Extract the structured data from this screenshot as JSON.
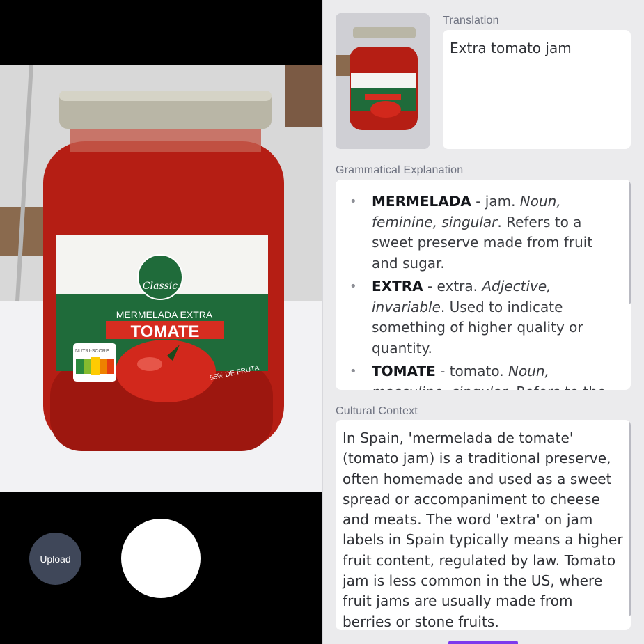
{
  "camera": {
    "upload_label": "Upload",
    "jar_label": {
      "brand": "Classic",
      "subtitle": "MERMELADA EXTRA",
      "title": "TOMATE",
      "nutri_score_label": "NUTRI-SCORE",
      "nutri_letters": [
        "A",
        "B",
        "C",
        "D",
        "E"
      ],
      "fruit_percent": "55% DE FRUTA"
    },
    "colors": {
      "jar_red": "#b51e14",
      "label_green": "#1f6b3a",
      "lid": "#b9b6a6",
      "upload_bg": "#3f4759"
    }
  },
  "panel": {
    "translation": {
      "label": "Translation",
      "text": "Extra tomato jam"
    },
    "grammar": {
      "label": "Grammatical Explanation",
      "items": [
        {
          "term": "MERMELADA",
          "meaning": " - jam. ",
          "grammar": "Noun, feminine, singular",
          "description": ". Refers to a sweet preserve made from fruit and sugar."
        },
        {
          "term": "EXTRA",
          "meaning": " - extra. ",
          "grammar": "Adjective, invariable",
          "description": ". Used to indicate something of higher quality or quantity."
        },
        {
          "term": "TOMATE",
          "meaning": " - tomato. ",
          "grammar": "Noun, masculine, singular",
          "description": ". Refers to the fruit."
        }
      ]
    },
    "culture": {
      "label": "Cultural Context",
      "text": "In Spain, 'mermelada de tomate' (tomato jam) is a traditional preserve, often homemade and used as a sweet spread or accompaniment to cheese and meats. The word 'extra' on jam labels in Spain typically means a higher fruit content, regulated by law. Tomato jam is less common in the US, where fruit jams are usually made from berries or stone fruits."
    },
    "accent_color": "#7c3aed"
  }
}
